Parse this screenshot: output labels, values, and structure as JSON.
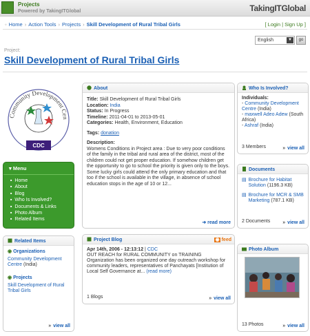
{
  "header": {
    "site_name": "Projects",
    "powered_by": "Powered by TakingITGlobal",
    "logo_text": "TakingITGlobal"
  },
  "breadcrumb": {
    "items": [
      "Home",
      "Action Tools",
      "Projects"
    ],
    "current": "Skill Development of Rural Tribal Girls"
  },
  "auth": {
    "login": "Login",
    "signup": "Sign Up"
  },
  "language": {
    "selected": "English",
    "go_label": "go"
  },
  "project": {
    "label": "Project:",
    "title": "Skill Development of Rural Tribal Girls"
  },
  "logo": {
    "ring_text": "Community Development Centre",
    "badge_text": "CDC"
  },
  "about": {
    "heading": "About",
    "title_label": "Title:",
    "title_value": "Skill Development of Rural Tribal Girls",
    "location_label": "Location:",
    "location_value": "India",
    "status_label": "Status:",
    "status_value": "In Progress",
    "timeline_label": "Timeline:",
    "timeline_value": "2011-04-01 to 2013-05-01",
    "categories_label": "Categories:",
    "categories_value": "Health, Environment, Education",
    "tags_label": "Tags:",
    "tags_value": "donation",
    "description_label": "Description:",
    "description_text": "Womens Conditions in Project area : Due to very poor conditions of the family in the tribal and rural area of the district, most of the children could not get proper education. If somehow children get the opportunity to go to school the priority is given only to the boys. Some lucky girls could attend the only primary education and that too if the school is available in the village, in absence of school education stops in the age of 10 or 12...",
    "read_more": "read more"
  },
  "menu": {
    "heading": "Menu",
    "items": [
      "Home",
      "About",
      "Blog",
      "Who Is Involved?",
      "Documents & Links",
      "Photo Album",
      "Related Items"
    ]
  },
  "related": {
    "heading": "Related Items",
    "org_heading": "Organizations",
    "org_name": "Community Development Centre",
    "org_suffix": "(India)",
    "proj_heading": "Projects",
    "proj_name": "Skill Development of Rural Tribal Girls",
    "view_all": "view all"
  },
  "who": {
    "heading": "Who Is Involved?",
    "subheading": "Individuals:",
    "p1_name": "Community Development Centre",
    "p1_suffix": "(India)",
    "p2_name": "maxwell Adeo Adew",
    "p2_suffix": "(South Africa)",
    "p3_name": "Ashraf",
    "p3_suffix": "(India)",
    "count": "3 Members",
    "view_all": "view all"
  },
  "documents": {
    "heading": "Documents",
    "d1_name": "Brochure for Habitat Solution",
    "d1_size": "(1196.3 KB)",
    "d2_name": "Brochure for MCR & SMB Marketing",
    "d2_size": "(787.1 KB)",
    "count": "2 Documents",
    "view_all": "view all"
  },
  "blog": {
    "heading": "Project Blog",
    "feed": "feed",
    "date": "Apr 14th, 2006 - 12:13:12",
    "source": "CDC",
    "text": "OUT REACH for RURAL COMMUNITY on TRAINING Organization has been organized one day outreach workshop for community leaders, representatives of Panchayats [Institution of Local Self Governance at...",
    "read_more": "(read more)",
    "count": "1 Blogs",
    "view_all": "view all"
  },
  "album": {
    "heading": "Photo Album",
    "count": "13 Photos",
    "view_all": "view all"
  }
}
